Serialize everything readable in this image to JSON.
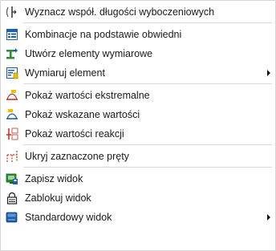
{
  "menu": {
    "items": [
      {
        "label": "Wyznacz współ. długości wyboczeniowych",
        "icon": "buckling-length-icon"
      },
      {
        "label": "Kombinacje na podstawie obwiedni",
        "icon": "envelope-combinations-icon"
      },
      {
        "label": "Utwórz elementy wymiarowe",
        "icon": "create-design-members-icon"
      },
      {
        "label": "Wymiaruj element",
        "icon": "design-member-icon",
        "submenu": true
      },
      {
        "label": "Pokaż wartości ekstremalne",
        "icon": "show-extreme-values-icon"
      },
      {
        "label": "Pokaż wskazane wartości",
        "icon": "show-selected-values-icon"
      },
      {
        "label": "Pokaż wartości reakcji",
        "icon": "show-reaction-values-icon"
      },
      {
        "label": "Ukryj zaznaczone pręty",
        "icon": "hide-selected-bars-icon"
      },
      {
        "label": "Zapisz widok",
        "icon": "save-view-icon"
      },
      {
        "label": "Zablokuj widok",
        "icon": "lock-view-icon"
      },
      {
        "label": "Standardowy widok",
        "icon": "standard-view-icon",
        "submenu": true
      }
    ]
  },
  "colors": {
    "separator": "#d9d9d9",
    "text": "#1a1a1a",
    "icon_blue": "#1f5fa8",
    "icon_green": "#2e8b2e",
    "icon_red": "#c0392b",
    "icon_yellow": "#f0c000"
  }
}
